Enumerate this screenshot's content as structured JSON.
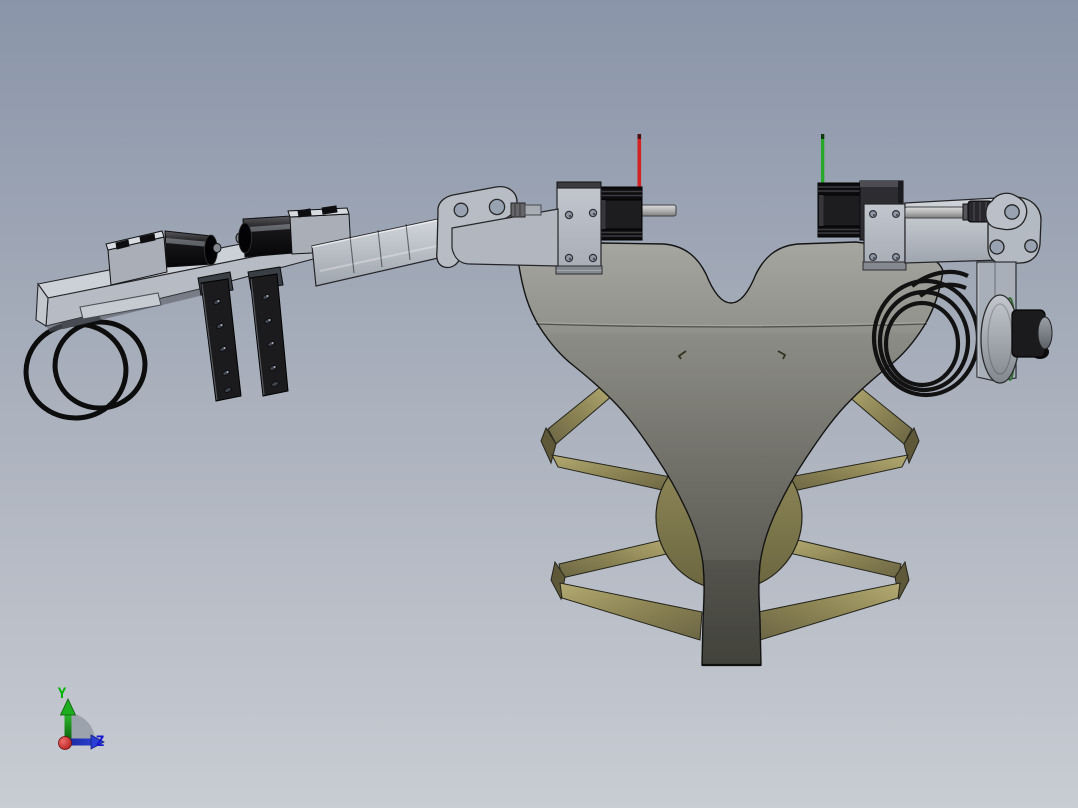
{
  "viewport": {
    "type": "cad-3d-viewport",
    "background_top": "#8a95a9",
    "background_middle": "#aeb4bf",
    "background_bottom": "#c8ccd3"
  },
  "axis_triad": {
    "y_label": "Y",
    "z_label": "Z",
    "y_axis_color": "#00b400",
    "z_axis_color": "#1717d2",
    "x_origin_color": "#c51f1f",
    "sector_color": "#7e858f"
  },
  "markers": {
    "left_marker_color": "#d42222",
    "right_marker_color": "#28a828"
  },
  "model": {
    "components": [
      {
        "name": "chassis-base",
        "color": "#c3c8cf"
      },
      {
        "name": "dc-gearmotor-left",
        "color": "#15151a"
      },
      {
        "name": "dc-gearmotor-right",
        "color": "#15151a"
      },
      {
        "name": "perforated-strap-front",
        "color": "#1b1b1d"
      },
      {
        "name": "perforated-strap-rear",
        "color": "#1b1b1d"
      },
      {
        "name": "o-ring-wheel-pair",
        "color": "#111111"
      },
      {
        "name": "telescopic-arm",
        "color": "#bcc1c9"
      },
      {
        "name": "elbow-linkage-left",
        "color": "#b8bdc5"
      },
      {
        "name": "stepper-motor-left",
        "color": "#1e1e21"
      },
      {
        "name": "mount-plate-left",
        "color": "#b4b9c1"
      },
      {
        "name": "stepper-shaft-left",
        "color": "#c0c0c0"
      },
      {
        "name": "stepper-motor-right",
        "color": "#1e1e21"
      },
      {
        "name": "gearbox-right",
        "color": "#2d2d31"
      },
      {
        "name": "mount-plate-right",
        "color": "#b4b9c1"
      },
      {
        "name": "link-arm-right",
        "color": "#b2b7bf"
      },
      {
        "name": "elbow-linkage-right",
        "color": "#b8bdc5"
      },
      {
        "name": "support-bracket-right",
        "color": "#a9afb8"
      },
      {
        "name": "roller-wheel-right",
        "color": "#b9bec6"
      },
      {
        "name": "roller-hub-right",
        "color": "#1b1b1e"
      },
      {
        "name": "coil-spring-right",
        "color": "#141414"
      },
      {
        "name": "funnel-body",
        "color": "#8d8d86"
      },
      {
        "name": "serpentine-band-left",
        "color": "#8e8757"
      },
      {
        "name": "serpentine-band-right",
        "color": "#8e8757"
      },
      {
        "name": "center-disc",
        "color": "#7d7650"
      }
    ]
  }
}
